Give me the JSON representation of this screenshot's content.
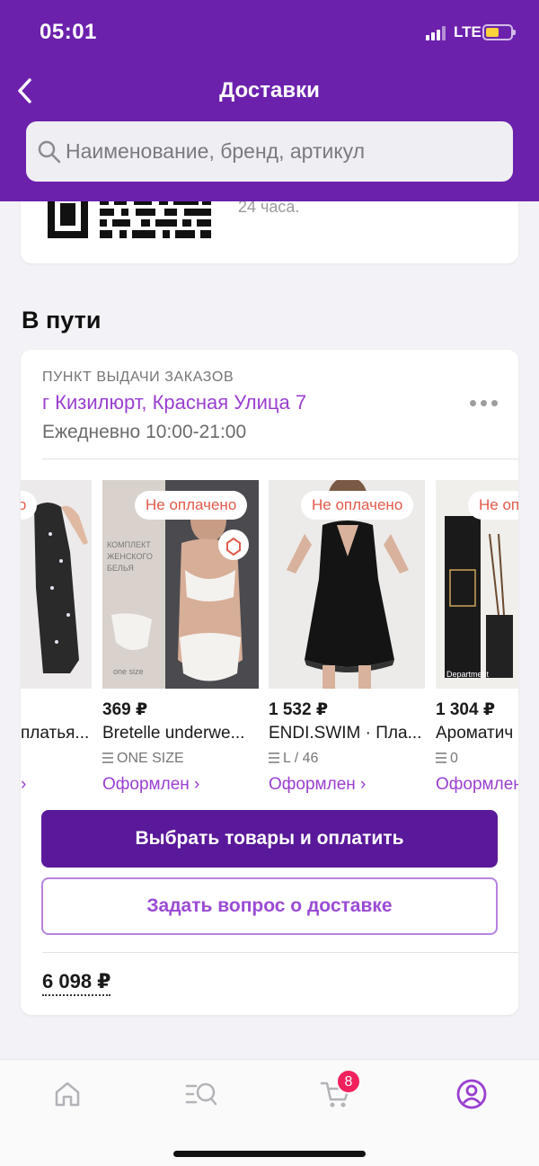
{
  "status_bar": {
    "time": "05:01",
    "network": "LTE"
  },
  "header": {
    "title": "Доставки"
  },
  "search": {
    "placeholder": "Наименование, бренд, артикул"
  },
  "qr_card": {
    "note": "24 часа."
  },
  "section": {
    "title": "В пути"
  },
  "pickup": {
    "label": "ПУНКТ ВЫДАЧИ ЗАКАЗОВ",
    "address": "г Кизилюрт, Красная Улица 7",
    "hours": "Ежедневно 10:00-21:00"
  },
  "products": [
    {
      "badge": "Не оплачено",
      "price": "",
      "name": "платья...",
      "size": "",
      "status": "›",
      "image": "floral-dress"
    },
    {
      "badge": "Не оплачено",
      "price": "369 ₽",
      "name": "Bretelle underwe...",
      "size": "ONE SIZE",
      "status": "Оформлен ›",
      "image": "underwear-set"
    },
    {
      "badge": "Не оплачено",
      "price": "1 532 ₽",
      "name": "ENDI.SWIM · Пла...",
      "size": "L / 46",
      "status": "Оформлен ›",
      "image": "black-dress"
    },
    {
      "badge": "Не оплачено",
      "price": "1 304 ₽",
      "name": "Ароматич",
      "size": "0",
      "status": "Оформлен",
      "image": "aroma-diffuser"
    }
  ],
  "buttons": {
    "pay": "Выбрать товары и оплатить",
    "ask": "Задать вопрос о доставке"
  },
  "total": "6 098 ₽",
  "bottom_nav": {
    "cart_count": "8"
  },
  "colors": {
    "brand": "#6c21ad",
    "accent": "#9a3fd0",
    "badge_red": "#f1215e",
    "unpaid_text": "#e25a4a"
  }
}
